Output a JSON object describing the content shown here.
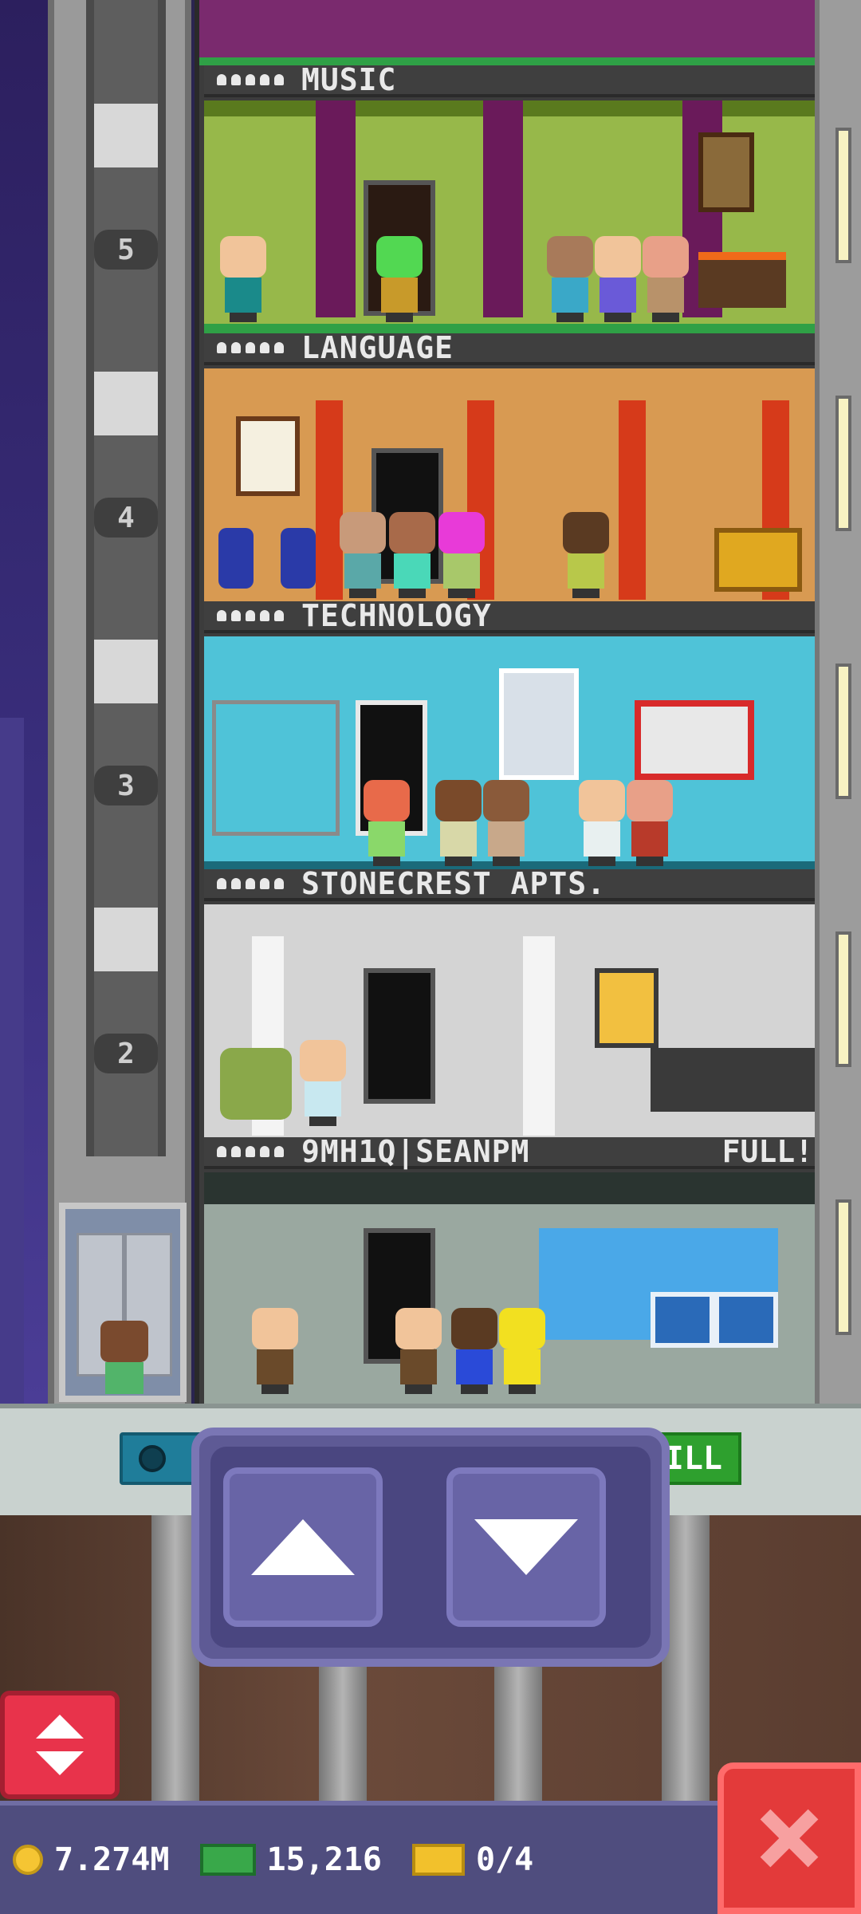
{
  "floors": [
    {
      "number": "5",
      "name": "MUSIC",
      "status": ""
    },
    {
      "number": "4",
      "name": "LANGUAGE",
      "status": ""
    },
    {
      "number": "3",
      "name": "TECHNOLOGY",
      "status": ""
    },
    {
      "number": "2",
      "name": "STONECREST APTS.",
      "status": ""
    },
    {
      "number": "",
      "name": "9MH1Q|SEANPM",
      "status": "FULL!"
    }
  ],
  "controls": {
    "green_button_label": "ILL"
  },
  "currency": {
    "coins": "7.274M",
    "bux": "15,216",
    "tickets": "0/4"
  },
  "icons": {
    "up": "up-arrow-icon",
    "down": "down-arrow-icon",
    "elevator_toggle": "elevator-updown-icon",
    "close": "close-x-icon"
  },
  "colors": {
    "close_red": "#e33a3a",
    "dpad_purple": "#5e5a95",
    "bux_green": "#39a84a",
    "coin_gold": "#f5c533"
  }
}
